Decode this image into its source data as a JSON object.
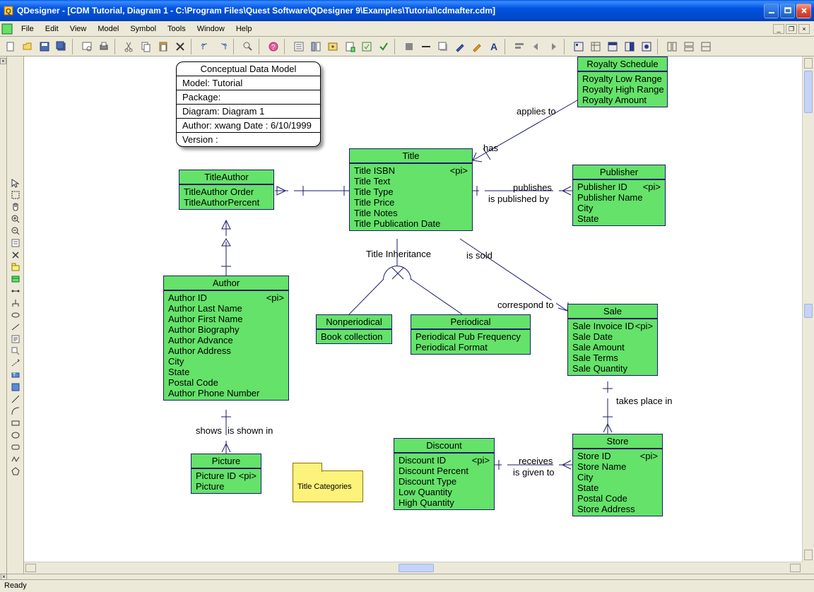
{
  "app": {
    "title": "QDesigner - [CDM Tutorial, Diagram 1 - C:\\Program Files\\Quest Software\\QDesigner 9\\Examples\\Tutorial\\cdmafter.cdm]"
  },
  "menu": {
    "file": "File",
    "edit": "Edit",
    "view": "View",
    "model": "Model",
    "symbol": "Symbol",
    "tools": "Tools",
    "window": "Window",
    "help": "Help"
  },
  "status": {
    "text": "Ready"
  },
  "info": {
    "header": "Conceptual Data Model",
    "model": "Model: Tutorial",
    "package": "Package:",
    "diagram": "Diagram: Diagram 1",
    "author": "Author: xwang    Date : 6/10/1999",
    "version": "Version :"
  },
  "entities": {
    "titleauthor": {
      "name": "TitleAuthor",
      "attrs": [
        "TitleAuthor Order",
        "TitleAuthorPercent"
      ]
    },
    "title": {
      "name": "Title",
      "piattr": "Title ISBN",
      "attrs": [
        "Title Text",
        "Title Type",
        "Title Price",
        "Title Notes",
        "Title Publication Date"
      ]
    },
    "royalty": {
      "name": "Royalty Schedule",
      "attrs": [
        "Royalty Low Range",
        "Royalty High Range",
        "Royalty Amount"
      ]
    },
    "publisher": {
      "name": "Publisher",
      "piattr": "Publisher ID",
      "attrs": [
        "Publisher Name",
        "City",
        "State"
      ]
    },
    "author": {
      "name": "Author",
      "piattr": "Author ID",
      "attrs": [
        "Author Last Name",
        "Author First Name",
        "Author Biography",
        "Author Advance",
        "Author Address",
        "City",
        "State",
        "Postal Code",
        "Author Phone Number"
      ]
    },
    "nonperiodical": {
      "name": "Nonperiodical",
      "attrs": [
        "Book collection"
      ]
    },
    "periodical": {
      "name": "Periodical",
      "attrs": [
        "Periodical Pub Frequency",
        "Periodical Format"
      ]
    },
    "sale": {
      "name": "Sale",
      "piattr": "Sale Invoice ID",
      "attrs": [
        "Sale Date",
        "Sale Amount",
        "Sale Terms",
        "Sale Quantity"
      ]
    },
    "picture": {
      "name": "Picture",
      "piattr": "Picture ID",
      "attrs": [
        "Picture"
      ]
    },
    "discount": {
      "name": "Discount",
      "piattr": "Discount ID",
      "attrs": [
        "Discount Percent",
        "Discount Type",
        "Low Quantity",
        "High Quantity"
      ]
    },
    "store": {
      "name": "Store",
      "piattr": "Store ID",
      "attrs": [
        "Store Name",
        "City",
        "State",
        "Postal Code",
        "Store Address"
      ]
    }
  },
  "relations": {
    "applies_to": "applies to",
    "has": "has",
    "publishes": "publishes",
    "is_published_by": "is published by",
    "title_inheritance": "Title Inheritance",
    "is_sold": "is sold",
    "correspond_to": "correspond to",
    "shows": "shows",
    "is_shown_in": "is shown in",
    "takes_place_in": "takes place in",
    "receives": "receives",
    "is_given_to": "is given to"
  },
  "package": {
    "label": "Title Categories"
  }
}
